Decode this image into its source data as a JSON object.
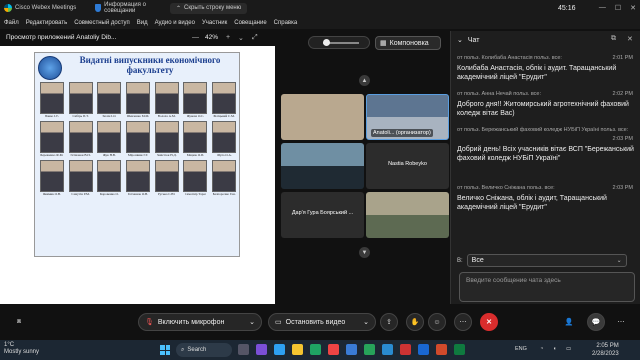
{
  "titlebar": {
    "app_name": "Cisco Webex Meetings",
    "info_label": "Информация о совещании",
    "hide_menu_label": "Скрыть строку меню",
    "timer": "45:16"
  },
  "menu": [
    "Файл",
    "Редактировать",
    "Совместный доступ",
    "Вид",
    "Аудио и видео",
    "Участник",
    "Совещание",
    "Справка"
  ],
  "share": {
    "title": "Просмотр приложений Anatoliy Dib...",
    "zoom": "42%"
  },
  "slide": {
    "title_line1": "Видатні випускники економічного",
    "title_line2": "факультету",
    "captions": [
      "Панко І.Є.",
      "Сибірь П.Т.",
      "Зюзін І.О.",
      "Шевченко М.М.",
      "Волоха А.М.",
      "Жукова О.С.",
      "Біліцький С.М.",
      "Береженко Ф.М.",
      "Гетманок В.П.",
      "Жук Н.В.",
      "Мірошник Г.Г.",
      "Завістюк Н.Д.",
      "Мацюк О.П.",
      "Шула О.А.",
      "Якимик О.В.",
      "Самутін Р.М.",
      "Коровенко О.",
      "Гетманок О.В.",
      "Руська С.Ю.",
      "Самотвір Тарас",
      "Безпорочне Ган."
    ]
  },
  "video_panel": {
    "zoom_slider_value": 0,
    "layout_label": "Компоновка",
    "tiles": [
      {
        "name": ""
      },
      {
        "name": "Anatoli... (организатор)"
      },
      {
        "name": ""
      },
      {
        "name": "Nastia Robeyko"
      },
      {
        "name": "Дар'я Гура Боярський ..."
      },
      {
        "name": ""
      }
    ]
  },
  "chat": {
    "title": "Чат",
    "messages": [
      {
        "meta": "от польз. Колибаба Анастасія польз. все:",
        "time": "2:01 PM",
        "text": "Колибаба Анастасія, облік і аудит. Таращанський академічний ліцей \"Ерудит\""
      },
      {
        "meta": "от польз. Анна Нечай польз. все:",
        "time": "2:02 PM",
        "text": "Доброго дня!! Житомирський агротехнічний фаховий коледж вітає Вас)"
      },
      {
        "meta": "от польз. Бережанський фаховий коледж НУБіП Україні польз. все:",
        "time": "2:03 PM",
        "text": "Добрий день! Всіх учасників вітає ВСП \"Бережанський фаховий коледж НУБіП Україні\""
      },
      {
        "meta": "от польз. Величко Сніжана польз. все:",
        "time": "2:03 PM",
        "text": "Величко Сніжана, облік і аудит, Таращанський академічний ліцей \"Ерудит\""
      }
    ],
    "to_label": "В:",
    "to_value": "Все",
    "input_placeholder": "Введите сообщение чата здесь"
  },
  "controls": {
    "mic_label": "Включить микрофон",
    "video_label": "Остановить видео"
  },
  "taskbar": {
    "temp": "1°C",
    "weather": "Mostly sunny",
    "search_label": "Search",
    "lang": "ENG",
    "time": "2:05 PM",
    "date": "2/28/2023"
  }
}
